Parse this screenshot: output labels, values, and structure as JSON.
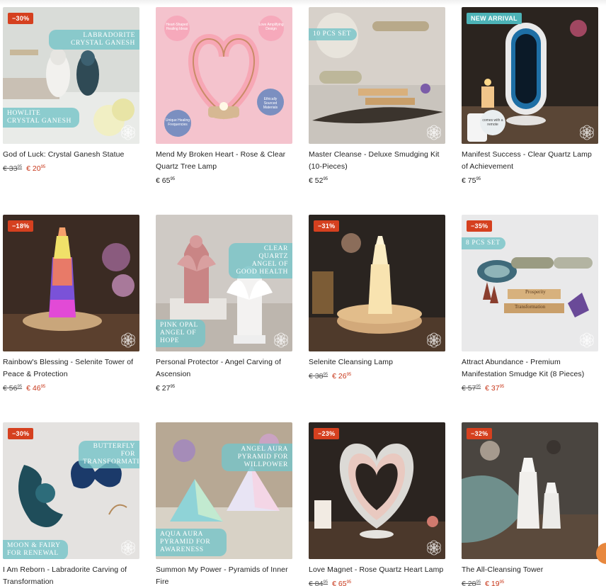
{
  "products": [
    {
      "title": "God of Luck: Crystal Ganesh Statue",
      "badge": "−30%",
      "old_price": "€ 33",
      "old_cents": "95",
      "price": "€ 20",
      "price_cents": "95",
      "overlays": [
        "LABRADORITE CRYSTAL GANESH",
        "HOWLITE CRYSTAL GANESH"
      ]
    },
    {
      "title": "Mend My Broken Heart - Rose & Clear Quartz Tree Lamp",
      "badge": "",
      "old_price": "",
      "old_cents": "",
      "price": "€ 65",
      "price_cents": "95",
      "overlays": [
        "Heart-Shaped Healing Ideas",
        "Love Amplifying Design",
        "Unique Healing Frequencies",
        "Ethically Sourced Materials"
      ]
    },
    {
      "title": "Master Cleanse - Deluxe Smudging Kit (10-Pieces)",
      "badge": "",
      "old_price": "",
      "old_cents": "",
      "price": "€ 52",
      "price_cents": "95",
      "overlays": [
        "10 PCS SET"
      ]
    },
    {
      "title": "Manifest Success - Clear Quartz Lamp of Achievement",
      "badge": "NEW ARRIVAL",
      "old_price": "",
      "old_cents": "",
      "price": "€ 75",
      "price_cents": "95",
      "overlays": [
        "comes with a remote"
      ]
    },
    {
      "title": "Rainbow's Blessing - Selenite Tower of Peace & Protection",
      "badge": "−18%",
      "old_price": "€ 56",
      "old_cents": "95",
      "price": "€ 46",
      "price_cents": "95",
      "overlays": []
    },
    {
      "title": "Personal Protector - Angel Carving of Ascension",
      "badge": "",
      "old_price": "",
      "old_cents": "",
      "price": "€ 27",
      "price_cents": "95",
      "overlays": [
        "CLEAR QUARTZ ANGEL OF GOOD HEALTH",
        "PINK OPAL ANGEL OF HOPE"
      ]
    },
    {
      "title": "Selenite Cleansing Lamp",
      "badge": "−31%",
      "old_price": "€ 38",
      "old_cents": "95",
      "price": "€ 26",
      "price_cents": "95",
      "overlays": []
    },
    {
      "title": "Attract Abundance - Premium Manifestation Smudge Kit (8 Pieces)",
      "badge": "−35%",
      "old_price": "€ 57",
      "old_cents": "95",
      "price": "€ 37",
      "price_cents": "95",
      "overlays": [
        "8 PCS SET",
        "Prosperity",
        "Transformation"
      ]
    },
    {
      "title": "I Am Reborn - Labradorite Carving of Transformation",
      "badge": "−30%",
      "old_price": "",
      "old_cents": "",
      "price": "",
      "price_cents": "",
      "overlays": [
        "BUTTERFLY FOR TRANSFORMATION",
        "MOON & FAIRY FOR RENEWAL"
      ]
    },
    {
      "title": "Summon My Power - Pyramids of Inner Fire",
      "badge": "",
      "old_price": "",
      "old_cents": "",
      "price": "",
      "price_cents": "",
      "overlays": [
        "ANGEL AURA PYRAMID FOR WILLPOWER",
        "AQUA AURA PYRAMID FOR AWARENESS"
      ]
    },
    {
      "title": "Love Magnet - Rose Quartz Heart Lamp",
      "badge": "−23%",
      "old_price": "€ 84",
      "old_cents": "95",
      "price": "€ 65",
      "price_cents": "95",
      "overlays": []
    },
    {
      "title": "The All-Cleansing Tower",
      "badge": "−32%",
      "old_price": "€ 28",
      "old_cents": "95",
      "price": "€ 19",
      "price_cents": "95",
      "overlays": []
    }
  ],
  "colors": {
    "sale_badge": "#d5401f",
    "new_badge": "#4db3b7",
    "sale_price": "#c8371a",
    "overlay_teal": "#78c4c8"
  },
  "icons": {
    "brand_mark": "flower-of-life-icon",
    "chat": "chat-bubble-icon"
  }
}
